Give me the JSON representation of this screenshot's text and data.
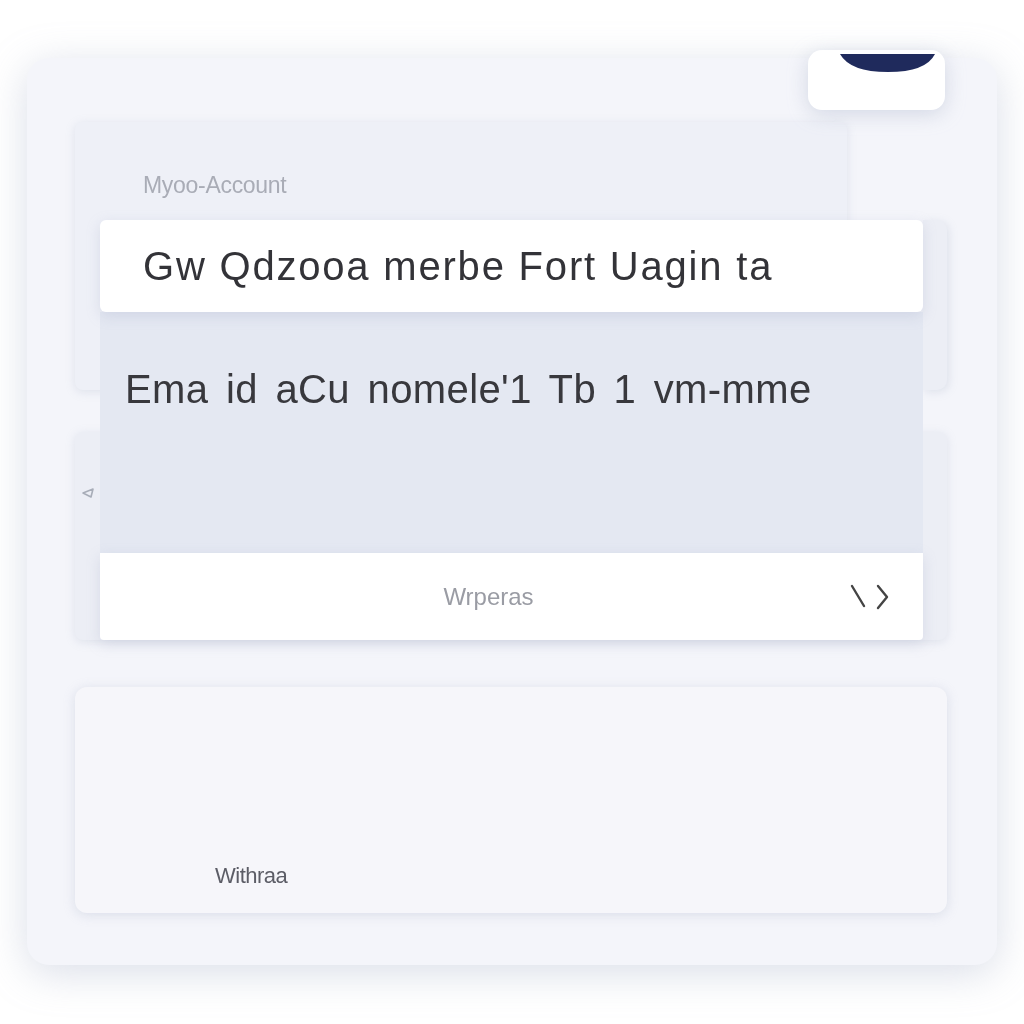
{
  "header": {
    "label": "Myoo-Account",
    "title": "Gw Qdzooa merbe Fort Uagin ta"
  },
  "message": {
    "text": "Ema id aCu nomele'1 Tb 1 vm-mme"
  },
  "action_row": {
    "label": "Wrperas"
  },
  "footer_card": {
    "label": "Withraa"
  }
}
